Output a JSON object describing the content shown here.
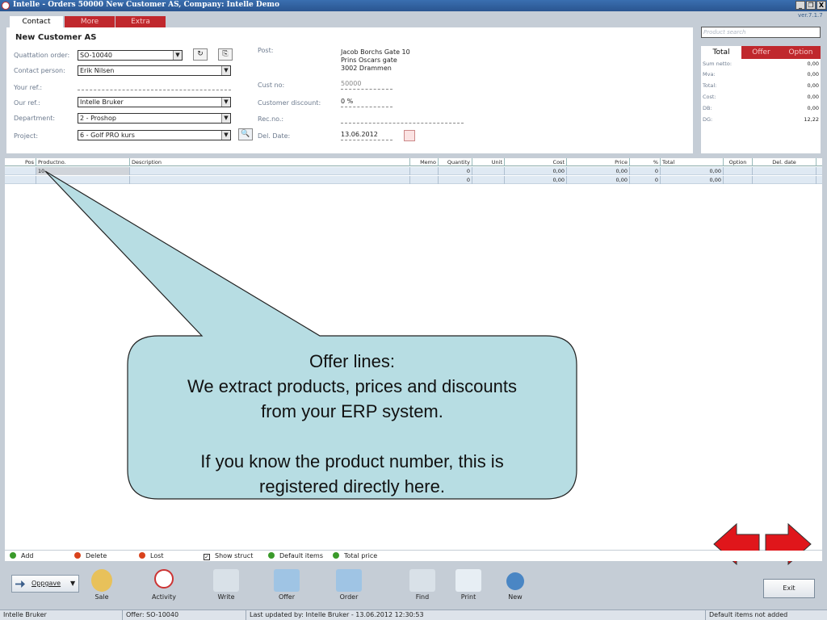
{
  "window": {
    "title": "Intelle - Orders  50000 New Customer AS,  Company: Intelle Demo",
    "version": "ver.7.1.7",
    "controls": [
      "_",
      "&#x2750;",
      "X"
    ]
  },
  "tabs": [
    "Contact",
    "More",
    "Extra"
  ],
  "contact": {
    "company": "New Customer AS",
    "labels": {
      "quotation_order": "Quattation order:",
      "contact_person": "Contact person:",
      "your_ref": "Your ref.:",
      "our_ref": "Our ref.:",
      "department": "Department:",
      "project": "Project:",
      "post": "Post:",
      "cust_no": "Cust no:",
      "customer_discount": "Customer discount:",
      "rec_no": "Rec.no.:",
      "del_date": "Del. Date:"
    },
    "values": {
      "quotation_order": "SO-10040",
      "contact_person": "Erik Nilsen",
      "your_ref": "",
      "our_ref": "Intelle Bruker",
      "department": "2 - Proshop",
      "project": "6 - Golf PRO kurs",
      "post_lines": [
        "Jacob Borchs Gate 10",
        "Prins Oscars gate",
        "3002 Drammen"
      ],
      "cust_no": "50000",
      "customer_discount": "0 %",
      "rec_no": "",
      "del_date": "13.06.2012"
    }
  },
  "product_search": {
    "placeholder": "Product search"
  },
  "totals": {
    "tabs": [
      "Total",
      "Offer",
      "Option"
    ],
    "rows": [
      {
        "label": "Sum netto:",
        "value": "0,00"
      },
      {
        "label": "Mva:",
        "value": "0,00"
      },
      {
        "label": "Total:",
        "value": "0,00"
      },
      {
        "label": "Cost:",
        "value": "0,00"
      },
      {
        "label": "DB:",
        "value": "0,00"
      },
      {
        "label": "DG:",
        "value": "12,22"
      }
    ]
  },
  "grid": {
    "headers": [
      "Pos",
      "Productno.",
      "Description",
      "Memo",
      "Quantity",
      "Unit",
      "Cost",
      "Price",
      "%",
      "Total",
      "Option",
      "Del. date"
    ],
    "rows": [
      {
        "pos": "",
        "productno": "10",
        "description": "",
        "memo": "",
        "quantity": "0",
        "unit": "",
        "cost": "0,00",
        "price": "0,00",
        "pct": "0",
        "total": "0,00",
        "option": "",
        "del_date": ""
      },
      {
        "pos": "",
        "productno": "",
        "description": "",
        "memo": "",
        "quantity": "0",
        "unit": "",
        "cost": "0,00",
        "price": "0,00",
        "pct": "0",
        "total": "0,00",
        "option": "",
        "del_date": ""
      }
    ]
  },
  "callout": {
    "title": "Offer lines:",
    "line1": "We extract products, prices and discounts",
    "line2": "from your ERP system.",
    "line3": "If you know the product number, this is",
    "line4": "registered directly here."
  },
  "actions": {
    "add": "Add",
    "delete": "Delete",
    "lost": "Lost",
    "show_struct": "Show struct",
    "show_struct_checked": true,
    "default_items": "Default items",
    "total_price": "Total price"
  },
  "toolbar": {
    "oppgave": "Oppgave",
    "sale": "Sale",
    "activity": "Activity",
    "write": "Write",
    "offer": "Offer",
    "order": "Order",
    "find": "Find",
    "print": "Print",
    "new": "New",
    "exit": "Exit"
  },
  "status": {
    "user": "Intelle Bruker",
    "offer": "Offer: SO-10040",
    "last_updated": "Last updated by: Intelle Bruker - 13.06.2012 12:30:53",
    "message": "Default items not added"
  },
  "colors": {
    "tab_red": "#c0282d",
    "callout_fill": "#b7dde3",
    "nav_arrow_red": "#e0161b"
  }
}
